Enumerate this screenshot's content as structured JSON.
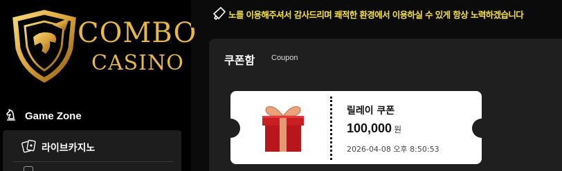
{
  "brand": {
    "line1": "COMBO",
    "line2": "CASINO",
    "gold": "#e6b84a"
  },
  "sidebar": {
    "section_label": "Game Zone",
    "section_icon": "chess-knight-icon",
    "items": [
      {
        "label": "라이브카지노",
        "icon": "playing-cards-icon"
      }
    ]
  },
  "notice": {
    "icon": "megaphone-icon",
    "text": "노를 이용해주셔서 감사드리며 쾌적한 환경에서 이용하실 수 있게 항상 노력하겠습니다",
    "color": "#f4e04a"
  },
  "panel": {
    "title": "쿠폰함",
    "subtitle": "Coupon"
  },
  "coupon": {
    "name": "릴레이 쿠폰",
    "amount": "100,000",
    "unit": "원",
    "datetime": "2026-04-08 오후 8:50:53",
    "icon": "gift-box-icon"
  }
}
